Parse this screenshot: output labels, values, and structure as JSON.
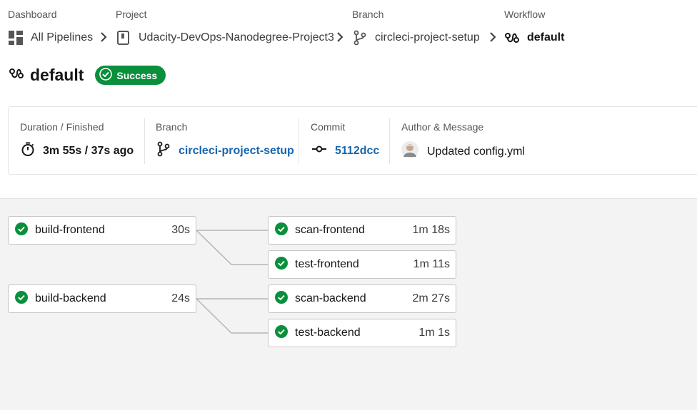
{
  "breadcrumbs": {
    "dashboard": {
      "label": "Dashboard",
      "value": "All Pipelines",
      "icon": "dashboard-grid-icon"
    },
    "project": {
      "label": "Project",
      "value": "Udacity-DevOps-Nanodegree-Project3",
      "icon": "repo-icon"
    },
    "branch": {
      "label": "Branch",
      "value": "circleci-project-setup",
      "icon": "git-branch-icon"
    },
    "workflow": {
      "label": "Workflow",
      "value": "default",
      "icon": "workflow-icon"
    }
  },
  "workflow": {
    "title": "default",
    "status": "Success",
    "status_color": "#0a8f3c"
  },
  "summary": {
    "duration": {
      "label": "Duration / Finished",
      "value": "3m 55s / 37s ago"
    },
    "branch": {
      "label": "Branch",
      "value": "circleci-project-setup"
    },
    "commit": {
      "label": "Commit",
      "value": "5112dcc"
    },
    "author": {
      "label": "Author & Message",
      "message": "Updated config.yml"
    }
  },
  "jobs": [
    {
      "name": "build-frontend",
      "duration": "30s",
      "status": "success"
    },
    {
      "name": "scan-frontend",
      "duration": "1m 18s",
      "status": "success"
    },
    {
      "name": "test-frontend",
      "duration": "1m 11s",
      "status": "success"
    },
    {
      "name": "build-backend",
      "duration": "24s",
      "status": "success"
    },
    {
      "name": "scan-backend",
      "duration": "2m 27s",
      "status": "success"
    },
    {
      "name": "test-backend",
      "duration": "1m 1s",
      "status": "success"
    }
  ],
  "colors": {
    "success": "#0a8f3c",
    "link": "#1766b0"
  }
}
